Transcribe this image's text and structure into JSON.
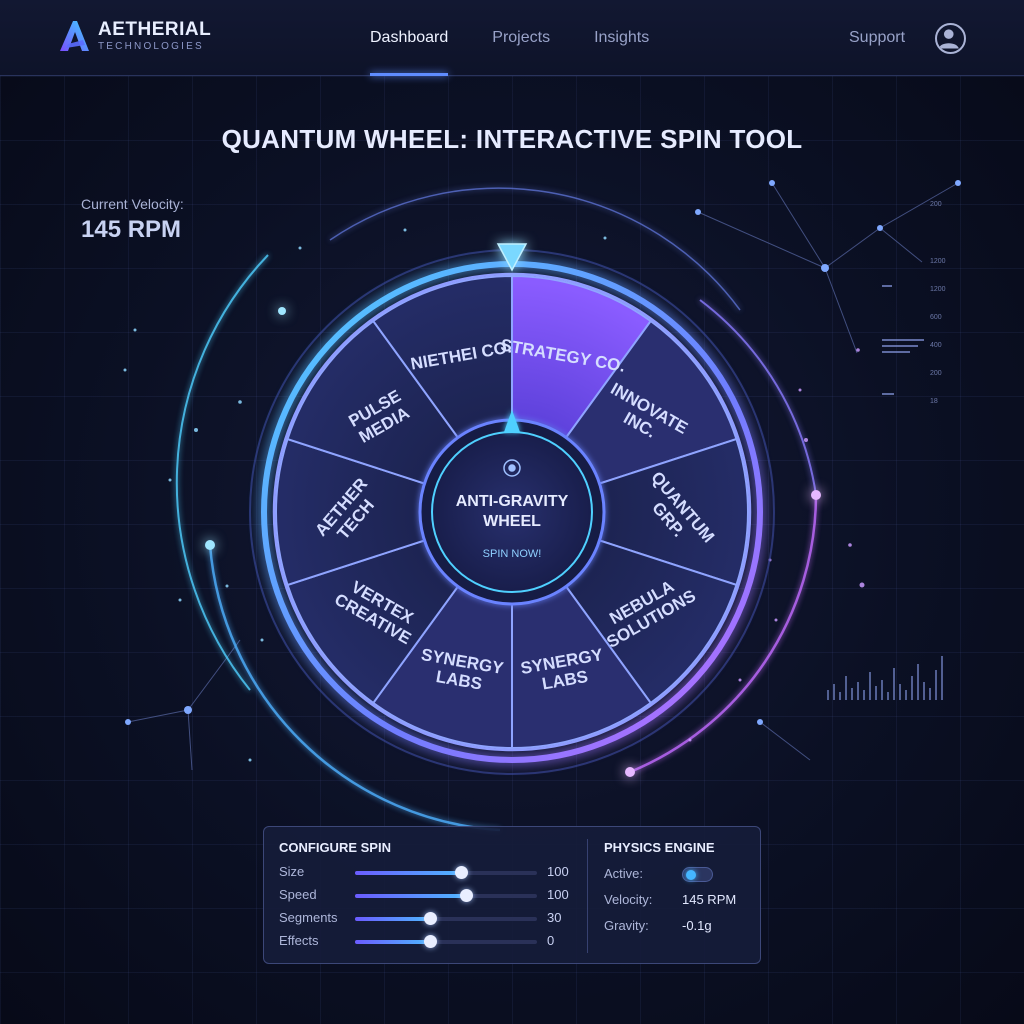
{
  "brand": {
    "name": "AETHERIAL",
    "subtitle": "TECHNOLOGIES",
    "logo_icon": "stylized-a-logo"
  },
  "nav": {
    "items": [
      {
        "label": "Dashboard",
        "active": true
      },
      {
        "label": "Projects",
        "active": false
      },
      {
        "label": "Insights",
        "active": false
      }
    ],
    "support_label": "Support",
    "avatar_icon": "user-avatar-icon"
  },
  "page": {
    "title": "QUANTUM WHEEL: INTERACTIVE SPIN TOOL",
    "velocity_label": "Current Velocity:",
    "velocity_value": "145 RPM"
  },
  "wheel": {
    "center_title_line1": "ANTI-GRAVITY",
    "center_title_line2": "WHEEL",
    "center_button": "SPIN NOW!",
    "center_icon": "orbit-icon",
    "pointer_icon": "triangle-pointer-icon",
    "segments": [
      {
        "line1": "STRATEGY CO.",
        "line2": ""
      },
      {
        "line1": "INNOVATE",
        "line2": "INC."
      },
      {
        "line1": "QUANTUM",
        "line2": "GRP."
      },
      {
        "line1": "NEBULA",
        "line2": "SOLUTIONS"
      },
      {
        "line1": "SYNERGY",
        "line2": "LABS"
      },
      {
        "line1": "SYNERGY",
        "line2": "LABS"
      },
      {
        "line1": "VERTEX",
        "line2": "CREATIVE"
      },
      {
        "line1": "AETHER",
        "line2": "TECH"
      },
      {
        "line1": "PULSE",
        "line2": "MEDIA"
      },
      {
        "line1": "NIETHEI CO.",
        "line2": ""
      }
    ],
    "colors": {
      "accent_cyan": "#4fd0ff",
      "accent_purple": "#b26bff",
      "highlight_segment": "#7b5cff"
    }
  },
  "side_axis": {
    "labels": [
      "200",
      "1200",
      "1200",
      "600",
      "400",
      "200",
      "18"
    ]
  },
  "config": {
    "title": "CONFIGURE SPIN",
    "sliders": [
      {
        "label": "Size",
        "value": "100",
        "fill": 0.58
      },
      {
        "label": "Speed",
        "value": "100",
        "fill": 0.61
      },
      {
        "label": "Segments",
        "value": "30",
        "fill": 0.41
      },
      {
        "label": "Effects",
        "value": "0",
        "fill": 0.41
      }
    ]
  },
  "physics": {
    "title": "PHYSICS ENGINE",
    "active_label": "Active:",
    "active_on": true,
    "velocity_label": "Velocity:",
    "velocity_value": "145 RPM",
    "gravity_label": "Gravity:",
    "gravity_value": "-0.1g"
  }
}
